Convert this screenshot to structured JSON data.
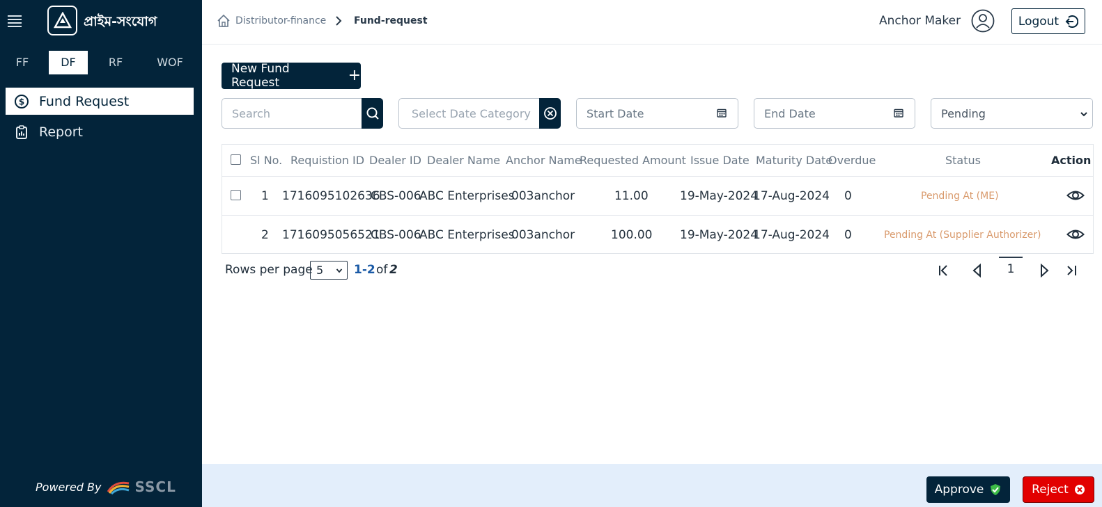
{
  "app": {
    "logo_text": "প্রাইম-সংযোগ"
  },
  "colors": {
    "sidebar_bg": "#03243a",
    "accent": "#03243a",
    "status": "#d99a6c",
    "reject": "#e20000",
    "footer_bg": "#e3eefb"
  },
  "module_tabs": [
    {
      "label": "FF",
      "active": false
    },
    {
      "label": "DF",
      "active": true
    },
    {
      "label": "RF",
      "active": false
    },
    {
      "label": "WOF",
      "active": false
    }
  ],
  "nav": [
    {
      "label": "Fund Request",
      "icon": "dollar-circle-icon",
      "active": true
    },
    {
      "label": "Report",
      "icon": "clipboard-chart-icon",
      "active": false
    }
  ],
  "powered_by": {
    "label": "Powered By",
    "brand": "SSCL"
  },
  "breadcrumb": {
    "parent": "Distributor-finance",
    "current": "Fund-request"
  },
  "user": {
    "name": "Anchor Maker",
    "logout_label": "Logout"
  },
  "new_button": {
    "label": "New Fund Request",
    "icon": "+"
  },
  "filters": {
    "search_placeholder": "Search",
    "date_category_placeholder": "Select Date Category",
    "start_date_placeholder": "Start Date",
    "end_date_placeholder": "End Date",
    "status_value": "Pending"
  },
  "table": {
    "headers": [
      "Sl No.",
      "Requistion ID",
      "Dealer ID",
      "Dealer Name",
      "Anchor Name",
      "Requested Amount",
      "Issue Date",
      "Maturity Date",
      "Overdue",
      "Status",
      "Action"
    ],
    "rows": [
      {
        "sl": "1",
        "requisition_id": "1716095102636",
        "dealer_id": "CBS-006",
        "dealer_name": "ABC Enterprises",
        "anchor_name": "003anchor",
        "amount": "11.00",
        "issue_date": "19-May-2024",
        "maturity_date": "17-Aug-2024",
        "overdue": "0",
        "status": "Pending At (ME)"
      },
      {
        "sl": "2",
        "requisition_id": "1716095056521",
        "dealer_id": "CBS-006",
        "dealer_name": "ABC Enterprises",
        "anchor_name": "003anchor",
        "amount": "100.00",
        "issue_date": "19-May-2024",
        "maturity_date": "17-Aug-2024",
        "overdue": "0",
        "status": "Pending At (Supplier Authorizer)"
      }
    ]
  },
  "pagination": {
    "rows_label": "Rows per page",
    "rows_value": "5",
    "range": "1-2",
    "of": "of",
    "total": "2",
    "current_page": "1"
  },
  "footer": {
    "approve_label": "Approve",
    "reject_label": "Reject"
  }
}
